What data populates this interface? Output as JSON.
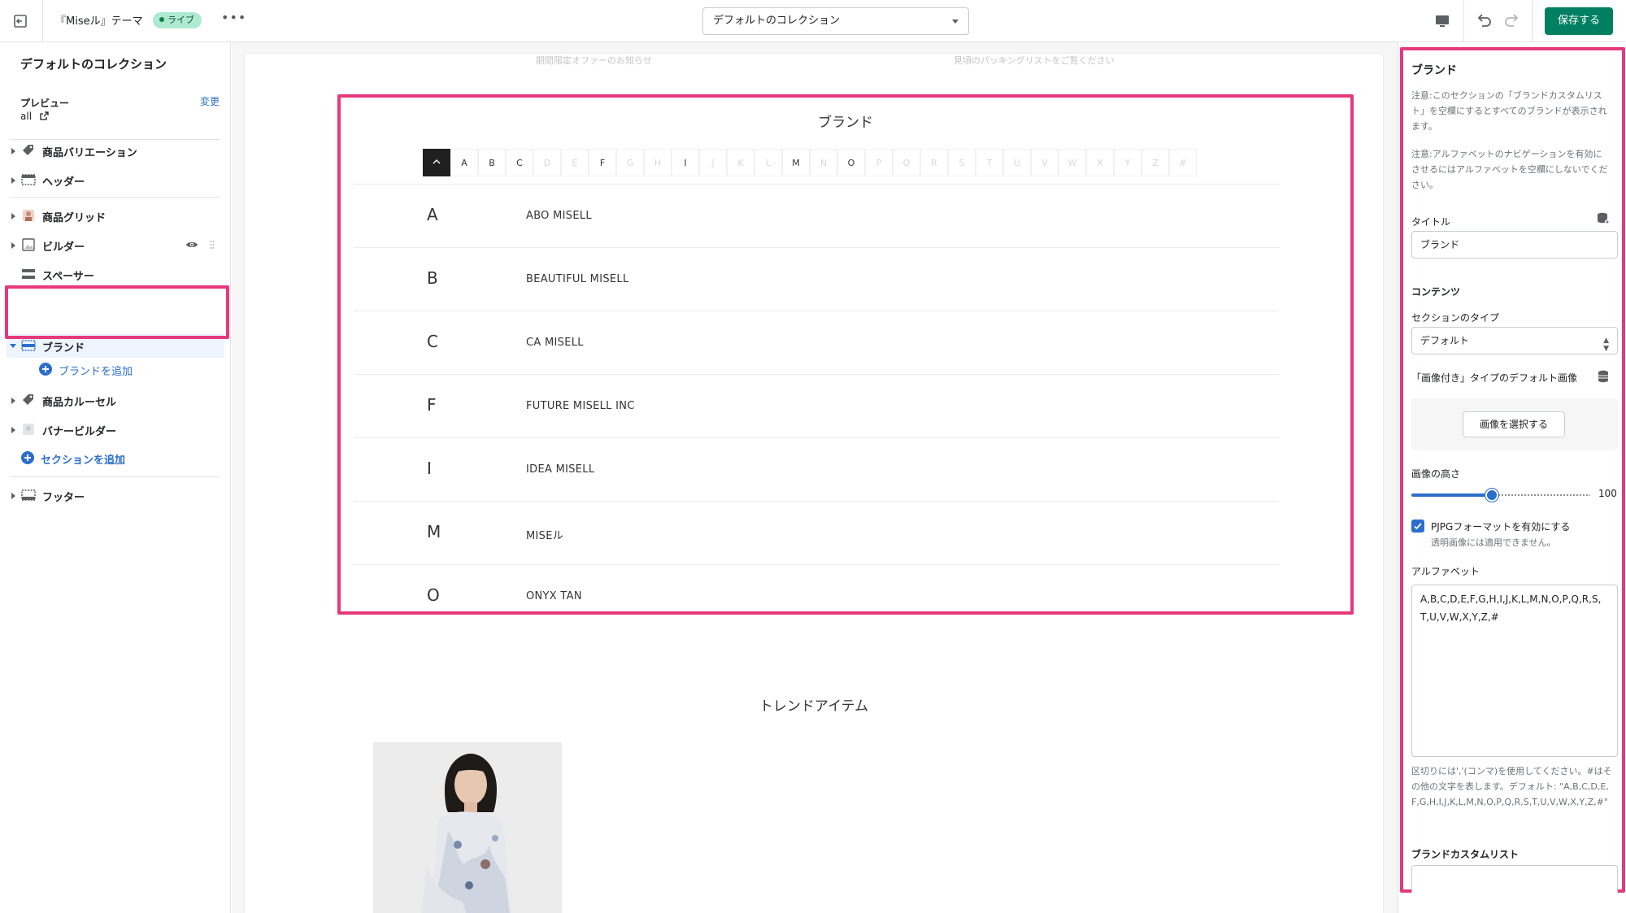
{
  "topbar": {
    "theme_name": "『Miseル』テーマ",
    "live_badge": "ライブ",
    "more_label": "•••",
    "template_select": "デフォルトのコレクション",
    "save_label": "保存する"
  },
  "sidebar": {
    "title": "デフォルトのコレクション",
    "preview_label": "プレビュー",
    "preview_value": "all",
    "change_label": "変更",
    "items": [
      {
        "label": "商品バリエーション"
      },
      {
        "label": "ヘッダー"
      },
      {
        "label": "商品グリッド"
      },
      {
        "label": "ビルダー"
      },
      {
        "label": "スペーサー"
      },
      {
        "label": "ブランド"
      },
      {
        "label": "商品カルーセル"
      },
      {
        "label": "バナービルダー"
      },
      {
        "label": "フッター"
      }
    ],
    "add_brand": "ブランドを追加",
    "add_section": "セクションを追加"
  },
  "preview": {
    "faded_left": "期間限定オファーのお知らせ",
    "faded_right": "見頃のパッキングリストをご覧ください",
    "brand_title": "ブランド",
    "alphabet": [
      "A",
      "B",
      "C",
      "D",
      "E",
      "F",
      "G",
      "H",
      "I",
      "J",
      "K",
      "L",
      "M",
      "N",
      "O",
      "P",
      "Q",
      "R",
      "S",
      "T",
      "U",
      "V",
      "W",
      "X",
      "Y",
      "Z",
      "#"
    ],
    "active_letters": [
      "A",
      "B",
      "C",
      "F",
      "I",
      "M",
      "O"
    ],
    "brands": [
      {
        "letter": "A",
        "name": "ABO MISELL"
      },
      {
        "letter": "B",
        "name": "BEAUTIFUL MISELL"
      },
      {
        "letter": "C",
        "name": "CA MISELL"
      },
      {
        "letter": "F",
        "name": "FUTURE MISELL INC"
      },
      {
        "letter": "I",
        "name": "IDEA MISELL"
      },
      {
        "letter": "M",
        "name": "MISEル"
      },
      {
        "letter": "O",
        "name": "ONYX TAN"
      }
    ],
    "trend_title": "トレンドアイテム"
  },
  "panel": {
    "heading": "ブランド",
    "note1": "注意:このセクションの「ブランドカスタムリスト」を空欄にするとすべてのブランドが表示されます。",
    "note2": "注意:アルファベットのナビゲーションを有効にさせるにはアルファベットを空欄にしないでください。",
    "title_label": "タイトル",
    "title_value": "ブランド",
    "content_label": "コンテンツ",
    "section_type_label": "セクションのタイプ",
    "section_type_value": "デフォルト",
    "default_image_label": "「画像付き」タイプのデフォルト画像",
    "select_image": "画像を選択する",
    "image_height_label": "画像の高さ",
    "image_height_value": "100",
    "image_height_fraction": 0.45,
    "pjpg_label": "PJPGフォーマットを有効にする",
    "pjpg_sub": "透明画像には適用できません。",
    "alphabet_label": "アルファベット",
    "alphabet_value": "A,B,C,D,E,F,G,H,I,J,K,L,M,N,O,P,Q,R,S,T,U,V,W,X,Y,Z,#",
    "alphabet_help": "区切りには','(コンマ)を使用してください。#はその他の文字を表します。デフォルト: \"A,B,C,D,E,F,G,H,I,J,K,L,M,N,O,P,Q,R,S,T,U,V,W,X,Y,Z,#\"",
    "custom_list_label": "ブランドカスタムリスト"
  },
  "colors": {
    "highlight": "#e6397b",
    "primary": "#2c6ecb",
    "save": "#008060"
  }
}
